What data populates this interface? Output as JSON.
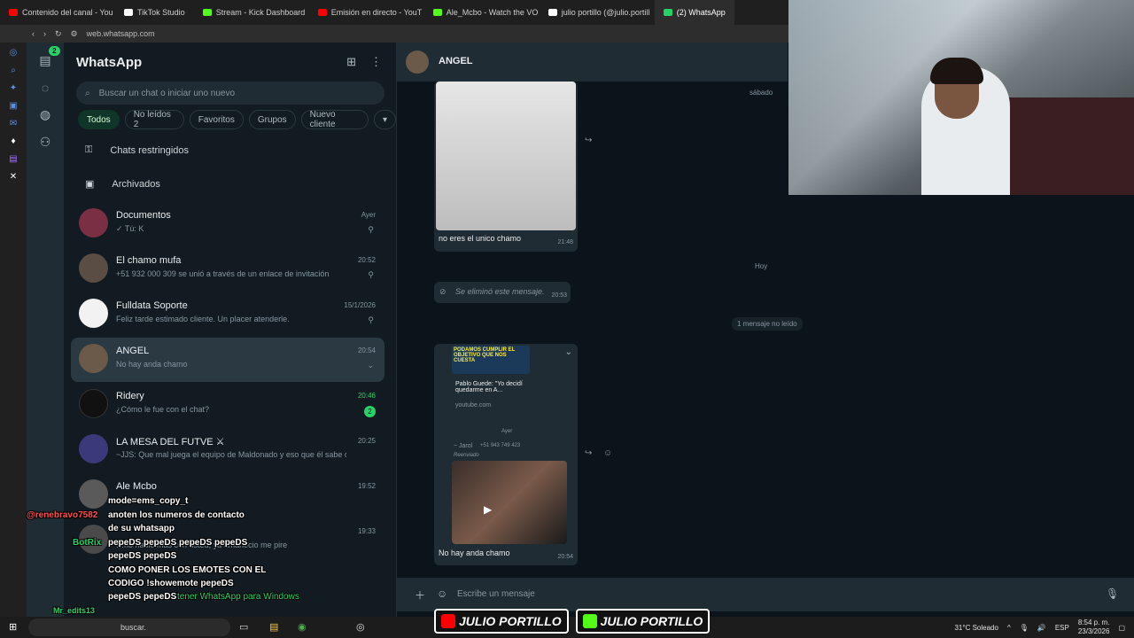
{
  "browser": {
    "tabs": [
      {
        "label": "Contenido del canal - You",
        "color": "#ff0000"
      },
      {
        "label": "TikTok Studio",
        "color": "#ffffff"
      },
      {
        "label": "Stream - Kick Dashboard",
        "color": "#53fc18"
      },
      {
        "label": "Emisión en directo - YouT",
        "color": "#ff0000"
      },
      {
        "label": "Ale_Mcbo - Watch the VO",
        "color": "#53fc18"
      },
      {
        "label": "julio portillo (@julio.portill",
        "color": "#ffffff"
      },
      {
        "label": "(2) WhatsApp",
        "color": "#25d366"
      }
    ],
    "url": "web.whatsapp.com"
  },
  "whatsapp": {
    "title": "WhatsApp",
    "chats_badge": "2",
    "search_placeholder": "Buscar un chat o iniciar uno nuevo",
    "filters": [
      "Todos",
      "No leídos 2",
      "Favoritos",
      "Grupos",
      "Nuevo cliente",
      "▾"
    ],
    "restricted": "Chats restringidos",
    "archived": "Archivados",
    "chats": [
      {
        "name": "Documentos",
        "msg": "✓ Tú: K",
        "time": "Ayer",
        "pinned": true,
        "avatar_color": "#7a2f45"
      },
      {
        "name": "El chamo mufa",
        "msg": "+51 932 000 309 se unió a través de un enlace de invitación",
        "time": "20:52",
        "pinned": true,
        "avatar_color": "#5a4e44"
      },
      {
        "name": "Fulldata Soporte",
        "msg": "Feliz tarde estimado cliente. Un placer atenderle.",
        "time": "15/1/2026",
        "pinned": true,
        "avatar_color": "#f2f2f2"
      },
      {
        "name": "ANGEL",
        "msg": "No hay anda chamo",
        "time": "20:54",
        "pinned": false,
        "avatar_color": "#6b5a4a"
      },
      {
        "name": "Ridery",
        "msg": "¿Cómo le fue con el chat?",
        "time": "20:46",
        "unread": "2",
        "avatar_color": "#111111"
      },
      {
        "name": "LA MESA DEL FUTVE ⚔",
        "msg": "~JJS: Que mal juega el equipo de Maldonado y eso que él sabe col...",
        "time": "20:25",
        "avatar_color": "#3a3a7a"
      },
      {
        "name": "Ale Mcbo",
        "msg": "",
        "time": "19:52",
        "avatar_color": "#5a5a5a"
      },
      {
        "name": "",
        "msg": "…no hablo más con usted, ya amanecio me pire",
        "time": "19:33",
        "avatar_color": "#4a4a4a"
      }
    ],
    "active_chat": {
      "name": "ANGEL",
      "day_saturday": "sábado",
      "msg1_text": "no eres el unico chamo",
      "msg1_time": "21:48",
      "day_today": "Hoy",
      "deleted_text": "Se eliminó este mensaje.",
      "deleted_time": "20:53",
      "unread_divider": "1 mensaje no leído",
      "yt_title": "Pablo Guede: \"Yo decidí quedarme en A...",
      "yt_source": "youtube.com",
      "yt_caption": "PODAMOS CUMPLIR EL OBJETIVO QUE NOS CUESTA",
      "inner_day": "Ayer",
      "fwd_sender": "~ Jarol",
      "fwd_number": "+51 943 749 423",
      "fwd_label": "Reenviado",
      "msg2_text": "No hay anda chamo",
      "msg2_time": "20:54",
      "composer_placeholder": "Escribe un mensaje"
    }
  },
  "stream_chat": [
    {
      "user": "",
      "text": "mode=ems_copy_t"
    },
    {
      "user": "@renebravo7582",
      "text": "anoten los numeros de contacto"
    },
    {
      "user": "",
      "text": "de su whatsapp"
    },
    {
      "user": "BotRix",
      "text": "pepeDS pepeDS pepeDS pepeDS"
    },
    {
      "user": "",
      "text": "pepeDS pepeDS"
    },
    {
      "user": "",
      "text": "COMO PONER LOS EMOTES CON EL"
    },
    {
      "user": "",
      "text": "CODIGO !showemote pepeDS"
    },
    {
      "user": "",
      "text": "pepeDS pepeDS"
    },
    {
      "user": "Mr_edits13",
      "text": ""
    },
    {
      "user": "",
      "text": "tener WhatsApp para Windows"
    }
  ],
  "taskbar": {
    "search": "buscar.",
    "weather": "31°C  Soleado",
    "lang": "ESP",
    "time": "8:54 p. m.",
    "date": "23/3/2026"
  },
  "overlay_brand": [
    "JULIO PORTILLO",
    "JULIO PORTILLO"
  ]
}
